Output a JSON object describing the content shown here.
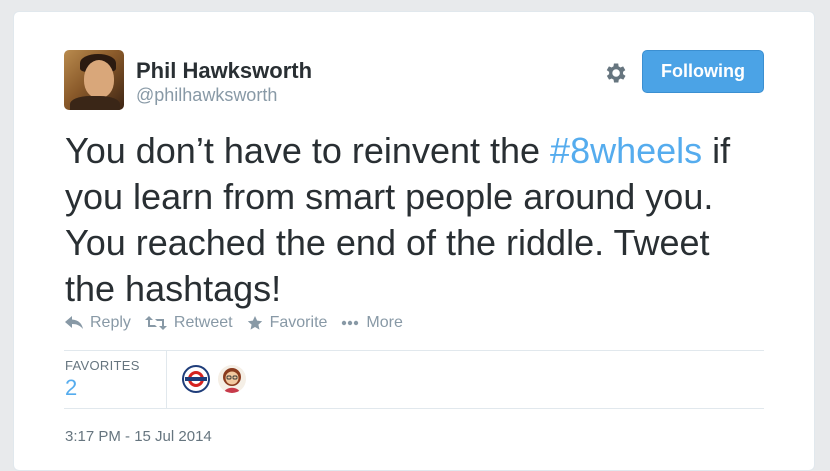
{
  "user": {
    "name": "Phil Hawksworth",
    "handle": "@philhawksworth"
  },
  "follow_button": {
    "label": "Following"
  },
  "tweet": {
    "text_before": "You don’t have to reinvent the ",
    "hashtag": "#8wheels",
    "text_after": " if you learn from smart people around you. You reached the end of the riddle. Tweet the hashtags!"
  },
  "actions": {
    "reply": "Reply",
    "retweet": "Retweet",
    "favorite": "Favorite",
    "more": "More"
  },
  "stats": {
    "favorites_label": "FAVORITES",
    "favorites_count": "2"
  },
  "timestamp": "3:17 PM - 15 Jul 2014",
  "colors": {
    "accent": "#55acee",
    "follow_button": "#4ba3e6",
    "muted_text": "#8899a6"
  },
  "icons": [
    "gear-icon",
    "reply-icon",
    "retweet-icon",
    "favorite-star-icon",
    "more-dots-icon"
  ]
}
